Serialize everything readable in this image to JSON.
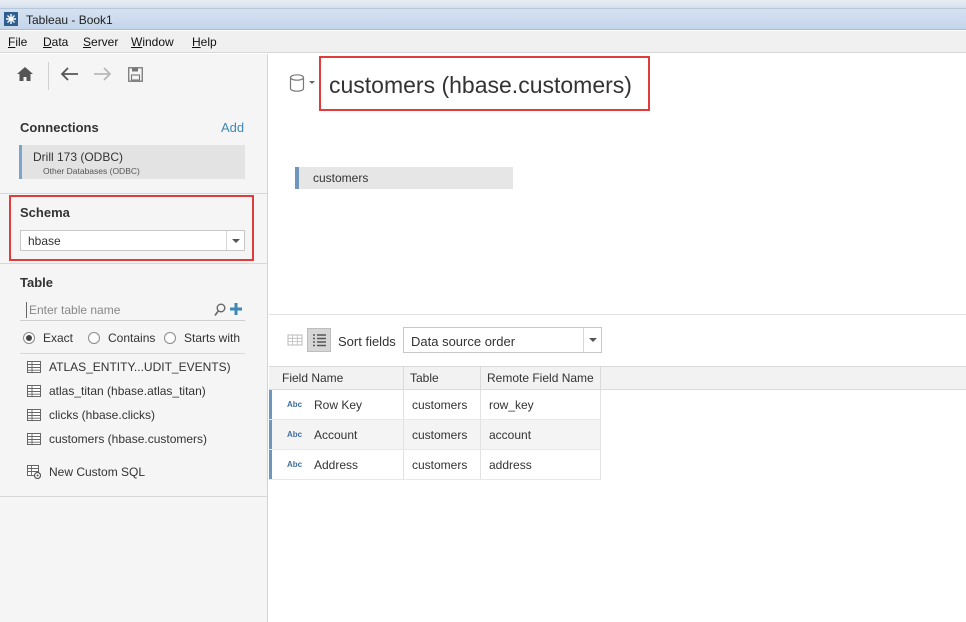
{
  "window": {
    "title": "Tableau - Book1"
  },
  "menu": [
    "File",
    "Data",
    "Server",
    "Window",
    "Help"
  ],
  "connections": {
    "heading": "Connections",
    "add_label": "Add",
    "items": [
      {
        "name": "Drill 173 (ODBC)",
        "type": "Other Databases (ODBC)"
      }
    ]
  },
  "schema": {
    "heading": "Schema",
    "selected": "hbase"
  },
  "table_section": {
    "heading": "Table",
    "search_placeholder": "Enter table name",
    "match_options": [
      "Exact",
      "Contains",
      "Starts with"
    ],
    "selected_match": "Exact",
    "tables": [
      "ATLAS_ENTITY...UDIT_EVENTS)",
      "atlas_titan (hbase.atlas_titan)",
      "clicks (hbase.clicks)",
      "customers (hbase.customers)"
    ],
    "custom_sql_label": "New Custom SQL"
  },
  "datasource": {
    "title": "customers (hbase.customers)",
    "canvas_table": "customers"
  },
  "grid_toolbar": {
    "sort_label": "Sort fields",
    "sort_selected": "Data source order"
  },
  "grid": {
    "columns": [
      "Field Name",
      "Table",
      "Remote Field Name"
    ],
    "type_badge": "Abc",
    "rows": [
      {
        "field": "Row Key",
        "table": "customers",
        "remote": "row_key"
      },
      {
        "field": "Account",
        "table": "customers",
        "remote": "account"
      },
      {
        "field": "Address",
        "table": "customers",
        "remote": "address"
      }
    ]
  },
  "colors": {
    "highlight": "#e03c3c",
    "accent": "#3f88b6",
    "row_marker": "#6f97bd"
  }
}
